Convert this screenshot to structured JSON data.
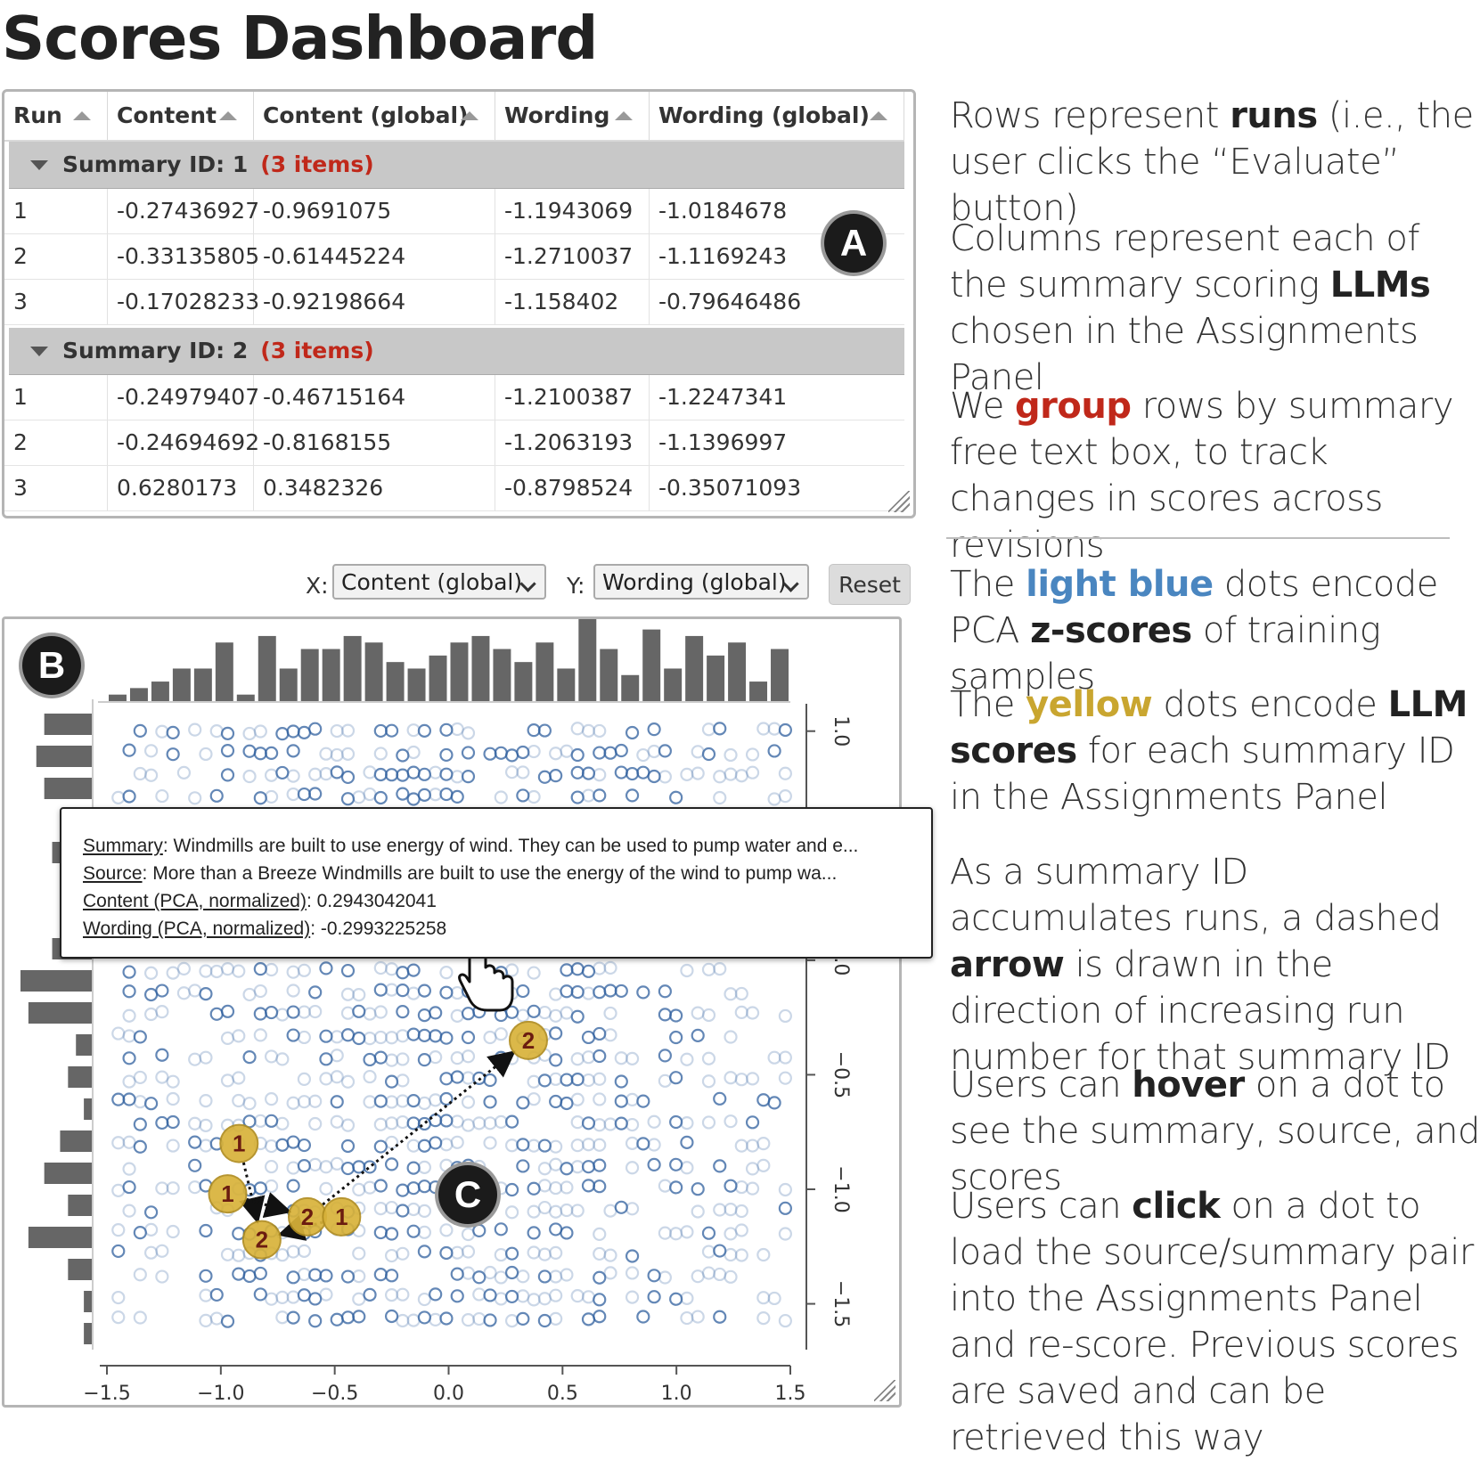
{
  "page_title": "Scores Dashboard",
  "table": {
    "columns": [
      "Run",
      "Content",
      "Content (global)",
      "Wording",
      "Wording (global)"
    ],
    "groups": [
      {
        "label": "Summary ID: 1",
        "count": "(3 items)",
        "rows": [
          [
            "1",
            "-0.27436927",
            "-0.9691075",
            "-1.1943069",
            "-1.0184678"
          ],
          [
            "2",
            "-0.33135805",
            "-0.61445224",
            "-1.2710037",
            "-1.1169243"
          ],
          [
            "3",
            "-0.17028233",
            "-0.92198664",
            "-1.158402",
            "-0.79646486"
          ]
        ]
      },
      {
        "label": "Summary ID: 2",
        "count": "(3 items)",
        "rows": [
          [
            "1",
            "-0.24979407",
            "-0.46715164",
            "-1.2100387",
            "-1.2247341"
          ],
          [
            "2",
            "-0.24694692",
            "-0.8168155",
            "-1.2063193",
            "-1.1396997"
          ],
          [
            "3",
            "0.6280173",
            "0.3482326",
            "-0.8798524",
            "-0.35071093"
          ]
        ]
      }
    ]
  },
  "badges": {
    "a": "A",
    "b": "B",
    "c": "C"
  },
  "controls": {
    "x_label": "X:",
    "x_value": "Content (global)",
    "y_label": "Y:",
    "y_value": "Wording (global)",
    "reset_label": "Reset"
  },
  "tooltip": {
    "summary_key": "Summary",
    "summary_value": ": Windmills are built to use energy of wind. They can be used to pump water and e...",
    "source_key": "Source",
    "source_value": ": More than a Breeze Windmills are built to use the energy of the wind to pump wa...",
    "content_key": "Content (PCA, normalized)",
    "content_value": ": 0.2943042041",
    "wording_key": "Wording (PCA, normalized)",
    "wording_value": ": -0.2993225258"
  },
  "notes": {
    "n1": [
      "Rows represent ",
      "runs",
      " (i.e., the user clicks the “Evaluate” button)"
    ],
    "n2": [
      "Columns represent each of the summary scoring ",
      "LLMs",
      " chosen in the Assignments Panel"
    ],
    "n3": [
      "We ",
      "group",
      " rows by summary free text box, to track changes in scores across revisions"
    ],
    "n4": [
      "The ",
      "light blue",
      " dots encode PCA ",
      "z-scores",
      " of training samples"
    ],
    "n5": [
      "The ",
      "yellow",
      " dots encode ",
      "LLM scores",
      " for each summary ID in the Assignments Panel"
    ],
    "n6": [
      "As a summary ID accumulates runs, a dashed ",
      "arrow",
      " is drawn in the direction of increasing run number for that summary ID"
    ],
    "n7": [
      "Users can ",
      "hover",
      " on a dot to see the summary, source, and scores"
    ],
    "n8": [
      "Users can ",
      "click",
      " on a dot to load the source/summary pair into the Assignments Panel and re-score. Previous scores are saved and can be retrieved this way"
    ]
  },
  "colors": {
    "training_dot": "#2f5f9e",
    "llm_dot": "#d8b23a",
    "histogram_bar": "#666666",
    "group_count": "#c0281a"
  },
  "chart_data": {
    "type": "scatter",
    "x_ticks": [
      "-1.5",
      "-1.0",
      "-0.5",
      "0.0",
      "0.5",
      "1.0",
      "1.5"
    ],
    "y_ticks": [
      "1.0",
      "0.5",
      "0.0",
      "-0.5",
      "-1.0",
      "-1.5"
    ],
    "xlim": [
      -1.5,
      1.5
    ],
    "ylim": [
      -1.7,
      1.1
    ],
    "top_histogram_counts": [
      1,
      2,
      3,
      5,
      5,
      9,
      1,
      10,
      5,
      8,
      8,
      10,
      9,
      6,
      5,
      7,
      9,
      10,
      8,
      6,
      9,
      5,
      13,
      8,
      4,
      11,
      5,
      10,
      7,
      9,
      3,
      8
    ],
    "left_histogram_counts": [
      6,
      7,
      6,
      2,
      5,
      3,
      2,
      5,
      9,
      8,
      2,
      3,
      1,
      4,
      6,
      3,
      8,
      3,
      1,
      1
    ],
    "llm_points": [
      {
        "label": "1",
        "summary_id": 1,
        "x": -0.97,
        "y": -1.02
      },
      {
        "label": "2",
        "summary_id": 1,
        "x": -0.62,
        "y": -1.12
      },
      {
        "label": "1",
        "summary_id": 2,
        "x": -0.92,
        "y": -0.8
      },
      {
        "label": "2",
        "summary_id": 2,
        "x": -0.82,
        "y": -1.22
      },
      {
        "label": "1",
        "summary_id": 2,
        "x": -0.47,
        "y": -1.12
      },
      {
        "label": "2",
        "summary_id": 2,
        "x": 0.35,
        "y": -0.35
      }
    ],
    "arrows": [
      {
        "from": [
          -0.92,
          -0.8
        ],
        "to": [
          -0.82,
          -1.22
        ]
      },
      {
        "from": [
          -0.97,
          -1.02
        ],
        "to": [
          -0.62,
          -1.12
        ]
      },
      {
        "from": [
          -0.62,
          -1.12
        ],
        "to": [
          0.35,
          -0.35
        ]
      },
      {
        "from": [
          -0.47,
          -1.12
        ],
        "to": [
          -0.82,
          -1.22
        ]
      }
    ]
  }
}
